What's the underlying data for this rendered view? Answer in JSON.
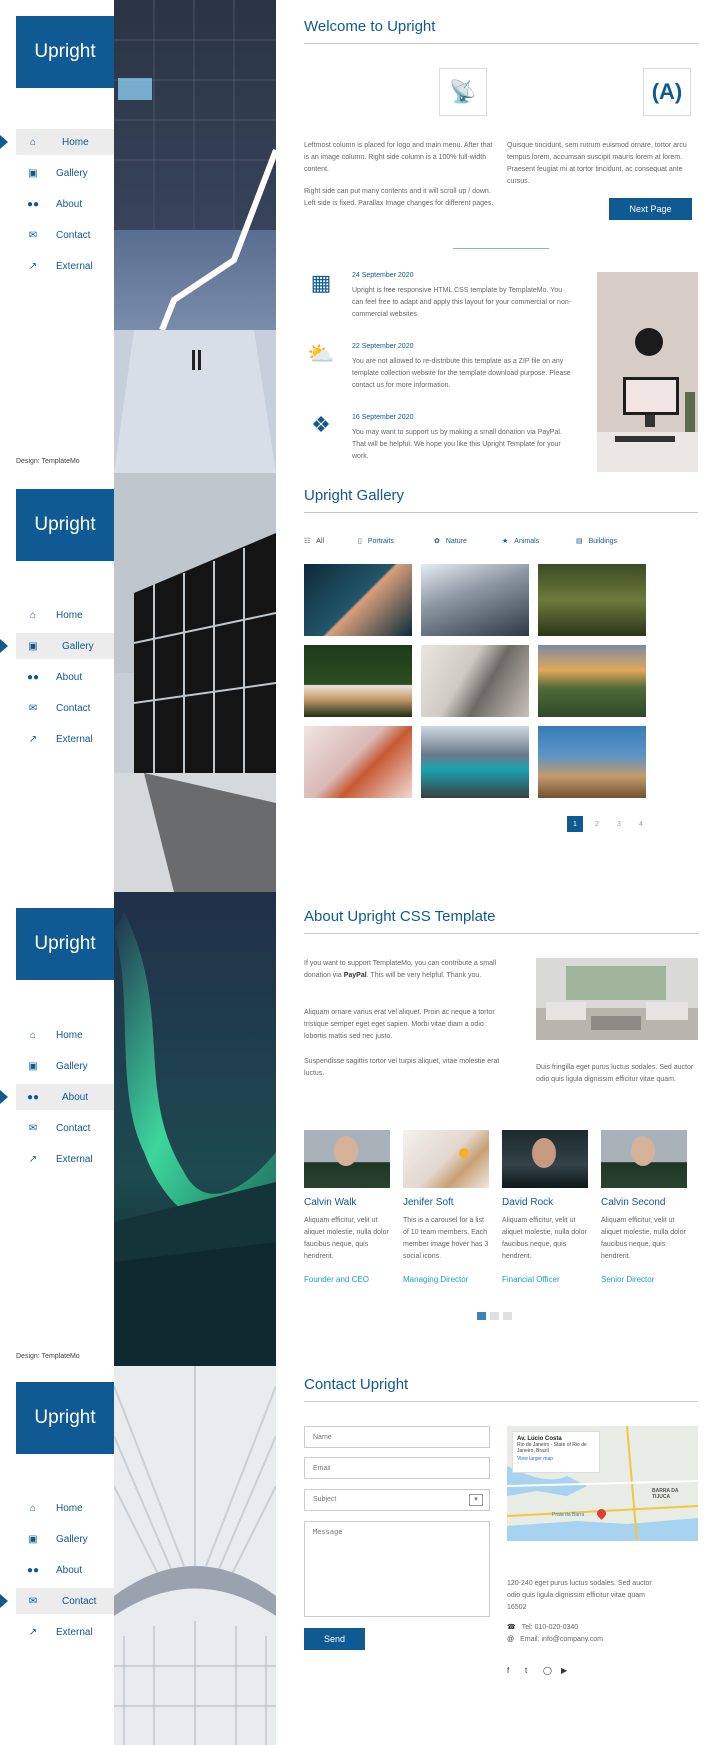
{
  "brand": "Upright",
  "design_credit": "Design: TemplateMo",
  "nav": [
    {
      "label": "Home",
      "icon": "home-icon"
    },
    {
      "label": "Gallery",
      "icon": "image-icon"
    },
    {
      "label": "About",
      "icon": "users-icon"
    },
    {
      "label": "Contact",
      "icon": "envelope-icon"
    },
    {
      "label": "External",
      "icon": "external-link-icon"
    }
  ],
  "welcome": {
    "title": "Welcome to Upright",
    "left_p1": "Leftmost column is placed for logo and main menu. After that is an image column. Right side column is a 100% full-width content.",
    "left_p2": "Right side can put many contents and it will scroll up / down. Left side is fixed. Parallax Image changes for different pages.",
    "right_p1": "Quisque tincidunt, sem rutrum euismod ornare, tortor arcu tempus lorem, accumsan suscipit mauris lorem at lorem. Praesent feugiat mi at tortor tincidunt, ac consequat ante cursus.",
    "next_button": "Next Page",
    "posts": [
      {
        "date": "24 September 2020",
        "text": "Upright is free responsive HTML CSS template by TemplateMo. You can feel free to adapt and apply this layout for your commercial or non-commercial websites.",
        "icon": "scroll-icon"
      },
      {
        "date": "22 September 2020",
        "text": "You are not allowed to re-distribute this template as a ZIP file on any template collection website for the template download purpose. Please contact us for more information.",
        "icon": "sun-cloud-icon"
      },
      {
        "date": "16 September 2020",
        "text": "You may want to support us by making a small donation via PayPal. That will be helpful. We hope you like this Upright Template for your work.",
        "icon": "dove-icon"
      }
    ]
  },
  "gallery": {
    "title": "Upright Gallery",
    "filters": [
      {
        "label": "All",
        "icon": "grid-icon"
      },
      {
        "label": "Portraits",
        "icon": "portrait-icon"
      },
      {
        "label": "Nature",
        "icon": "leaf-icon"
      },
      {
        "label": "Animals",
        "icon": "paw-icon"
      },
      {
        "label": "Buildings",
        "icon": "building-icon"
      }
    ],
    "pages": [
      "1",
      "2",
      "3",
      "4"
    ]
  },
  "about": {
    "title": "About Upright CSS Template",
    "p1_a": "If you want to support TemplateMo, you can contribute a small donation via ",
    "p1_b": "PayPal",
    "p1_c": ". This will be very helpful. Thank you.",
    "p2": "Aliquam ornare varius erat vel aliquet. Proin ac neque a tortor tristique semper eget eget sapien. Morbi vitae diam a odio lobortis mattis sed nec justo.",
    "p3": "Suspendisse sagittis tortor vel turpis aliquet, vitae molestie erat luctus.",
    "caption": "Duis fringilla eget purus luctus sodales. Sed auctor odio quis ligula dignissim efficitur vitae quam.",
    "members": [
      {
        "name": "Calvin Walk",
        "text": "Aliquam efficitur, velit ut aliquet molestie, nulla dolor faucibus neque, quis hendrerit.",
        "role": "Founder and CEO"
      },
      {
        "name": "Jenifer Soft",
        "text": "This is a carousel for a list of 10 team members. Each member image hover has 3 social icons.",
        "role": "Managing Director"
      },
      {
        "name": "David Rock",
        "text": "Aliquam efficitur, velit ut aliquet molestie, nulla dolor faucibus neque, quis hendrerit.",
        "role": "Financial Officer"
      },
      {
        "name": "Calvin Second",
        "text": "Aliquam efficitur, velit ut aliquet molestie, nulla dolor faucibus neque, quis hendrerit.",
        "role": "Senior Director"
      }
    ]
  },
  "contact": {
    "title": "Contact Upright",
    "name_ph": "Name",
    "email_ph": "Email",
    "subject_ph": "Subject",
    "message_ph": "Message",
    "send": "Send",
    "map_place": "Av. Lúcio Costa",
    "map_addr": "Rio de Janeiro - State of Rio de Janeiro, Brazil",
    "map_link": "View larger map",
    "map_label1": "BARRA DA TIJUCA",
    "map_label2": "Praia da Barra",
    "address": "120-240 eget purus luctus sodales. Sed auctor odio quis ligula dignissim efficitur vitae quam 16502",
    "tel": "Tel: 010-020-0340",
    "email": "Email: info@company.com"
  },
  "colors": {
    "brand": "#0f5a92",
    "accent": "#1a9fc2"
  }
}
